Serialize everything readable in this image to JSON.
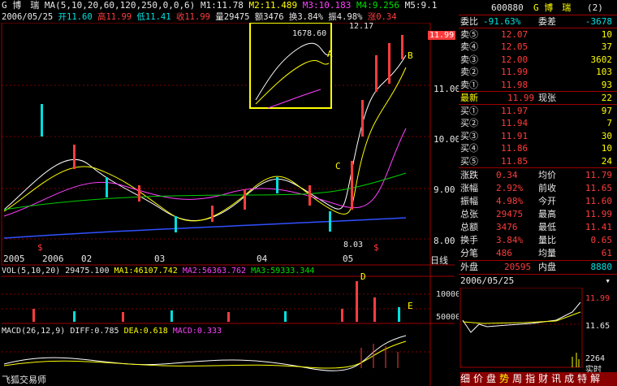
{
  "header": {
    "stock_name": "G 博　瑞",
    "ma_label": "MA(5,10,20,60,120,250,0,0,6)",
    "m1": "M1:11.78",
    "m2": "M2:11.489",
    "m3": "M3:10.183",
    "m4": "M4:9.256",
    "m5": "M5:9.1",
    "date": "2006/05/25",
    "open": "开11.60",
    "high": "高11.99",
    "low": "低11.41",
    "close": "收11.99",
    "volume": "量29475",
    "amount": "额3476",
    "turnover": "换3.84%",
    "amplitude": "振4.98%",
    "change": "涨0.34"
  },
  "chart": {
    "price_axis": [
      "11.00",
      "10.00",
      "9.00",
      "8.00"
    ],
    "price_tag": "11.99",
    "high_label": "12.17",
    "low_label": "8.03",
    "inset_label": "1678.60",
    "annotations": {
      "A": "A",
      "B": "B",
      "C": "C",
      "D": "D",
      "E": "E"
    },
    "markers": [
      "$",
      "$"
    ],
    "x_labels": [
      "2005",
      "2006",
      "02",
      "03",
      "04",
      "05"
    ],
    "period": "日线",
    "vol_label": "VOL(5,10,20)",
    "vol_val": "29475.100",
    "vol_ma1": "MA1:46107.742",
    "vol_ma2": "MA2:56363.762",
    "vol_ma3": "MA3:59333.344",
    "vol_axis": [
      "100000",
      "50000"
    ],
    "macd_label": "MACD(26,12,9)",
    "diff": "DIFF:0.785",
    "dea": "DEA:0.618",
    "macd": "MACD:0.333",
    "watermark": "飞狐交易师"
  },
  "chart_data": {
    "type": "line",
    "title": "",
    "ylim": [
      7.8,
      12.4
    ],
    "x": [
      "2005",
      "2006",
      "02",
      "03",
      "04",
      "05"
    ],
    "series": [
      {
        "name": "M1",
        "values": [
          8.7,
          9.1,
          8.6,
          8.3,
          9.2,
          8.4,
          11.78
        ]
      },
      {
        "name": "M2",
        "values": [
          8.8,
          9.2,
          8.7,
          8.4,
          9.1,
          8.6,
          11.489
        ]
      },
      {
        "name": "M3",
        "values": [
          8.9,
          9.2,
          8.9,
          8.6,
          8.9,
          8.8,
          10.183
        ]
      }
    ]
  },
  "quote": {
    "code": "600880",
    "name": "G 博　瑞",
    "suffix": "(2)",
    "weibi_label": "委比",
    "weibi": "-91.63%",
    "weicha_label": "委差",
    "weicha": "-3678",
    "asks": [
      {
        "label": "卖⑤",
        "price": "12.07",
        "vol": "10"
      },
      {
        "label": "卖④",
        "price": "12.05",
        "vol": "37"
      },
      {
        "label": "卖③",
        "price": "12.00",
        "vol": "3602"
      },
      {
        "label": "卖②",
        "price": "11.99",
        "vol": "103"
      },
      {
        "label": "卖①",
        "price": "11.98",
        "vol": "93"
      }
    ],
    "last_label": "最新",
    "last": "11.99",
    "now_label": "现张",
    "now": "22",
    "bids": [
      {
        "label": "买①",
        "price": "11.97",
        "vol": "97"
      },
      {
        "label": "买②",
        "price": "11.94",
        "vol": "7"
      },
      {
        "label": "买③",
        "price": "11.91",
        "vol": "30"
      },
      {
        "label": "买④",
        "price": "11.86",
        "vol": "10"
      },
      {
        "label": "买⑤",
        "price": "11.85",
        "vol": "24"
      }
    ],
    "stats": [
      {
        "l1": "涨跌",
        "v1": "0.34",
        "l2": "均价",
        "v2": "11.79"
      },
      {
        "l1": "涨幅",
        "v1": "2.92%",
        "l2": "前收",
        "v2": "11.65"
      },
      {
        "l1": "振幅",
        "v1": "4.98%",
        "l2": "今开",
        "v2": "11.60"
      },
      {
        "l1": "总张",
        "v1": "29475",
        "l2": "最高",
        "v2": "11.99"
      },
      {
        "l1": "总额",
        "v1": "3476",
        "l2": "最低",
        "v2": "11.41"
      },
      {
        "l1": "换手",
        "v1": "3.84%",
        "l2": "量比",
        "v2": "0.65"
      },
      {
        "l1": "分笔",
        "v1": "486",
        "l2": "均量",
        "v2": "61"
      }
    ],
    "outer_label": "外盘",
    "outer": "20595",
    "inner_label": "内盘",
    "inner": "8880",
    "mini_date": "2006/05/25",
    "mini_hi": "11.99",
    "mini_lo": "11.65",
    "mini_vol": "2264",
    "mini_mode": "实时",
    "tabs": [
      "细",
      "价",
      "盘",
      "势",
      "周",
      "指",
      "财",
      "讯",
      "成",
      "特",
      "解"
    ]
  }
}
